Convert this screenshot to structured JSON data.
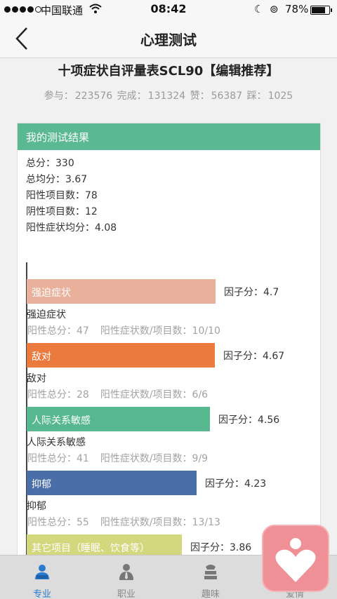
{
  "status_bar": {
    "carrier": "中国联通",
    "time": "08:42",
    "battery": "78%"
  },
  "nav": {
    "title": "心理测试"
  },
  "test": {
    "title": "十项症状自评量表SCL90【编辑推荐】",
    "stats": {
      "join_label": "参与：",
      "join": "223576",
      "done_label": "完成：",
      "done": "131324",
      "like_label": "赞：",
      "like": "56387",
      "dislike_label": "踩：",
      "dislike": "1025"
    }
  },
  "result": {
    "header": "我的测试结果",
    "summary": [
      "总分：330",
      "总均分：3.67",
      "阳性项目数：78",
      "阴性项目数：12",
      "阳性症状均分：4.08"
    ]
  },
  "factors": [
    {
      "name": "强迫症状",
      "score_text": "因子分：4.7",
      "score": 4.7,
      "color": "#e9b19b",
      "positive_total": "阳性总分：47",
      "ratio": "阳性症状数/项目数：10/10"
    },
    {
      "name": "敌对",
      "score_text": "因子分：4.67",
      "score": 4.67,
      "color": "#ea7a3e",
      "positive_total": "阳性总分：28",
      "ratio": "阳性症状数/项目数：6/6"
    },
    {
      "name": "人际关系敏感",
      "score_text": "因子分：4.56",
      "score": 4.56,
      "color": "#57b88f",
      "positive_total": "阳性总分：41",
      "ratio": "阳性症状数/项目数：9/9"
    },
    {
      "name": "抑郁",
      "score_text": "因子分：4.23",
      "score": 4.23,
      "color": "#4a6fa8",
      "positive_total": "阳性总分：55",
      "ratio": "阳性症状数/项目数：13/13"
    },
    {
      "name": "其它项目（睡眠、饮食等）",
      "score_text": "因子分：3.86",
      "score": 3.86,
      "color": "#d3d77d",
      "positive_total": "",
      "ratio": ""
    }
  ],
  "tabs": [
    {
      "label": "专业",
      "icon": "professional-icon",
      "active": true
    },
    {
      "label": "职业",
      "icon": "career-icon",
      "active": false
    },
    {
      "label": "趣味",
      "icon": "fun-icon",
      "active": false
    },
    {
      "label": "爱情",
      "icon": "love-icon",
      "active": false
    }
  ],
  "float_button": {
    "icon": "heart-person-icon"
  }
}
